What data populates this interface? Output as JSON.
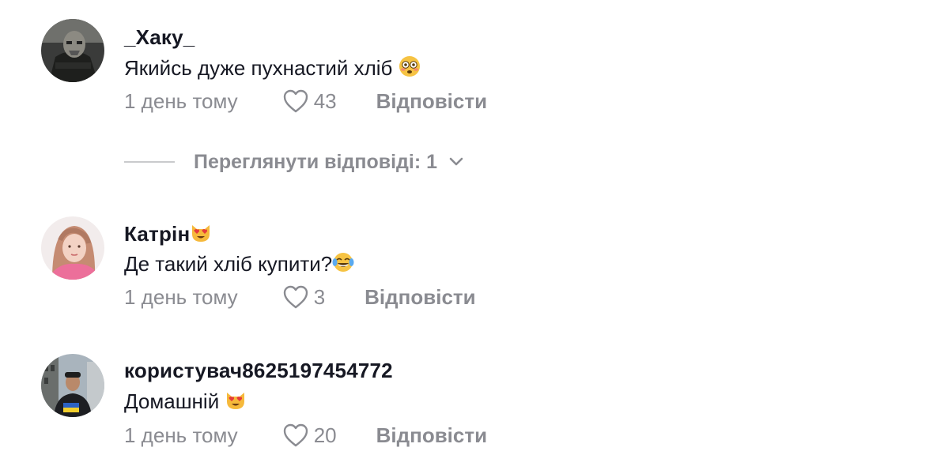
{
  "comments": [
    {
      "username": "_Хаку_",
      "text": "Якийсь дуже пухнастий хліб",
      "text_emoji": "flushed-face-emoji",
      "time": "1 день тому",
      "likes": "43",
      "reply_label": "Відповісти",
      "avatar": "avatar-masked-person"
    },
    {
      "username": "Катрін",
      "username_emoji": "heart-eyes-cat-emoji",
      "text": "Де такий хліб купити?",
      "text_emoji": "tears-of-joy-emoji",
      "time": "1 день тому",
      "likes": "3",
      "reply_label": "Відповісти",
      "avatar": "avatar-girl-pink"
    },
    {
      "username": "користувач8625197454772",
      "text": "Домашній",
      "text_emoji": "heart-eyes-cat-emoji",
      "time": "1 день тому",
      "likes": "20",
      "reply_label": "Відповісти",
      "avatar": "avatar-man-street"
    }
  ],
  "view_replies": {
    "label": "Переглянути відповіді: 1",
    "icon": "chevron-down-icon"
  },
  "colors": {
    "text": "#161823",
    "muted": "#8a8b91",
    "background": "#ffffff"
  }
}
